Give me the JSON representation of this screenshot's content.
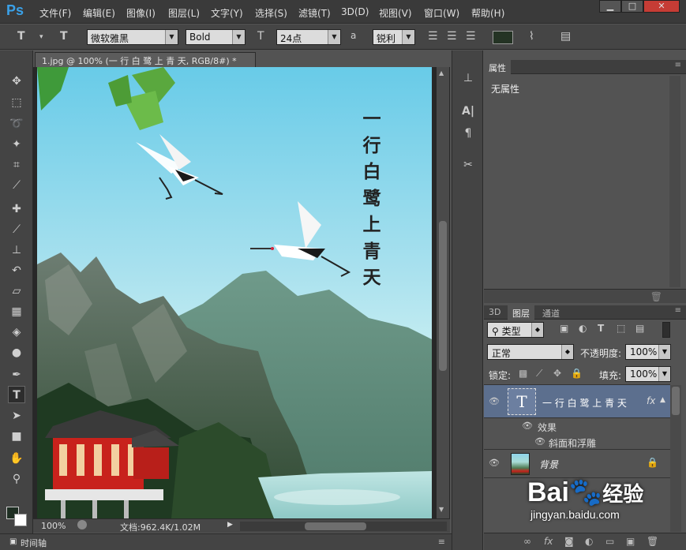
{
  "app": {
    "logo": "Ps"
  },
  "menu": [
    "文件(F)",
    "编辑(E)",
    "图像(I)",
    "图层(L)",
    "文字(Y)",
    "选择(S)",
    "滤镜(T)",
    "3D(D)",
    "视图(V)",
    "窗口(W)",
    "帮助(H)"
  ],
  "window_controls": {
    "minimize": "▁",
    "maximize": "□",
    "close": "✕"
  },
  "options": {
    "tool_glyph": "T",
    "font_family": "微软雅黑",
    "font_style": "Bold",
    "font_size": "24点",
    "antialias_prefix": "a",
    "antialias": "锐利",
    "color": "#243324"
  },
  "document": {
    "tab_title": "1.jpg @ 100% (一 行 白 鹭 上 青 天, RGB/8#) *",
    "close_glyph": "×",
    "vertical_text": [
      "一",
      "行",
      "白",
      "鹭",
      "上",
      "青",
      "天"
    ],
    "zoom": "100%",
    "doc_info": "文档:962.4K/1.02M"
  },
  "timeline_label": "时间轴",
  "properties": {
    "tab": "属性",
    "content": "无属性"
  },
  "layers": {
    "tabs": [
      "3D",
      "图层",
      "通道"
    ],
    "active_tab": "图层",
    "filter_label": "类型",
    "blend_mode": "正常",
    "opacity_label": "不透明度:",
    "opacity": "100%",
    "lock_label": "锁定:",
    "fill_label": "填充:",
    "fill": "100%",
    "items": [
      {
        "name": "一 行 白 鹭 上 青 天",
        "thumb": "T",
        "fx": "fx"
      },
      {
        "name": "效果"
      },
      {
        "name": "斜面和浮雕"
      },
      {
        "name": "背景"
      }
    ]
  },
  "watermark": {
    "brand": "Bai",
    "brand2": "经验",
    "url": "jingyan.baidu.com"
  }
}
